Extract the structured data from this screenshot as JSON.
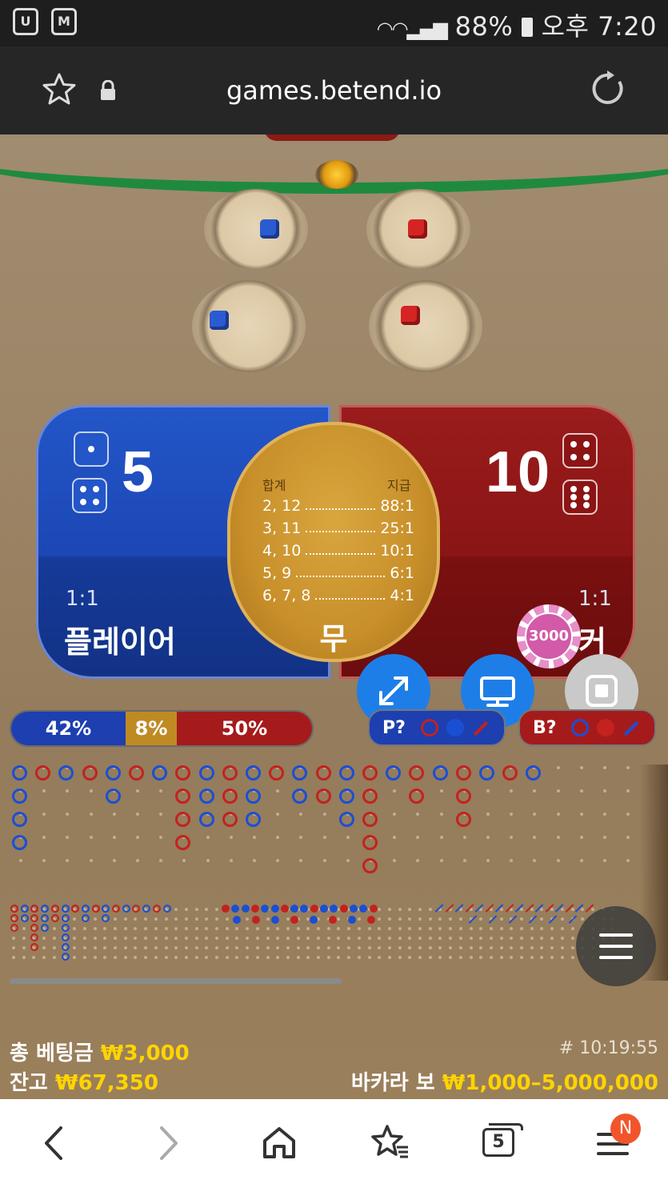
{
  "status_bar": {
    "left_icon_1": "u-app-icon",
    "left_icon_2": "lock-m-icon",
    "battery": "88%",
    "time": "오후 7:20"
  },
  "browser": {
    "url": "games.betend.io"
  },
  "game": {
    "player": {
      "score": "5",
      "ratio": "1:1",
      "name": "플레이어",
      "dice": [
        1,
        4
      ],
      "color": "#1c47b5"
    },
    "banker": {
      "score": "10",
      "ratio": "1:1",
      "name_visible": "커",
      "dice": [
        4,
        6
      ],
      "color": "#8a1515"
    },
    "tie": {
      "header_left": "합계",
      "header_right": "지급",
      "payouts": [
        {
          "sums": "2, 12",
          "pay": "88:1"
        },
        {
          "sums": "3, 11",
          "pay": "25:1"
        },
        {
          "sums": "4, 10",
          "pay": "10:1"
        },
        {
          "sums": "5, 9",
          "pay": "6:1"
        },
        {
          "sums": "6, 7, 8",
          "pay": "4:1"
        }
      ],
      "name": "무"
    },
    "chip_value": "3000",
    "stats": {
      "player_pct": "42%",
      "tie_pct": "8%",
      "banker_pct": "50%"
    },
    "predict_player": "P?",
    "predict_banker": "B?",
    "buttons": [
      "expand-icon",
      "monitor-icon",
      "stop-icon",
      "menu-icon"
    ]
  },
  "info": {
    "total_bet_label": "총 베팅금",
    "total_bet_value": "₩3,000",
    "balance_label": "잔고",
    "balance_value": "₩67,350",
    "round_id": "# 10:19:55",
    "table_name": "바카라 보",
    "limits": "₩1,000–5,000,000"
  },
  "nav": {
    "tabs_count": "5",
    "badge": "N"
  }
}
